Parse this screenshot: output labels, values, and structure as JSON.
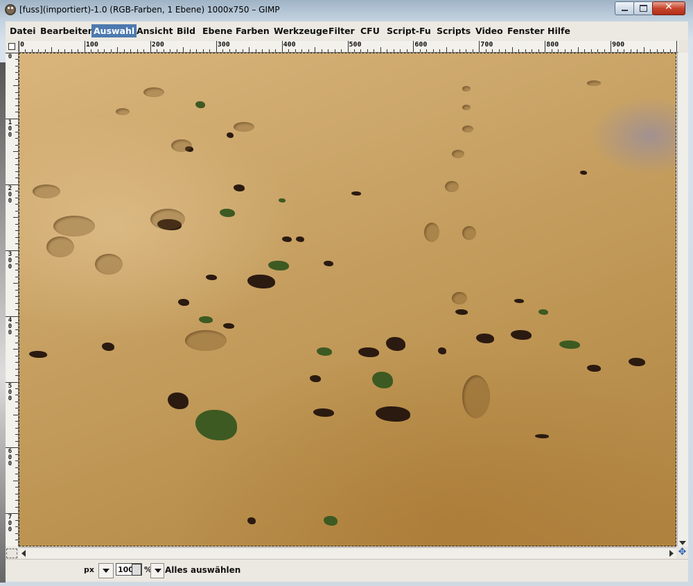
{
  "window": {
    "title": "[fuss](importiert)-1.0 (RGB-Farben, 1 Ebene) 1000x750 – GIMP",
    "app_icon": "gimp-wilber-icon"
  },
  "menubar": {
    "items": [
      {
        "label": "Datei"
      },
      {
        "label": "Bearbeiten"
      },
      {
        "label": "Auswahl",
        "active": true
      },
      {
        "label": "Ansicht"
      },
      {
        "label": "Bild"
      },
      {
        "label": "Ebene"
      },
      {
        "label": "Farben"
      },
      {
        "label": "Werkzeuge"
      },
      {
        "label": "Filter"
      },
      {
        "label": "CFU"
      },
      {
        "label": "Script-Fu"
      },
      {
        "label": "Scripts"
      },
      {
        "label": "Video"
      },
      {
        "label": "Fenster"
      },
      {
        "label": "Hilfe"
      }
    ]
  },
  "rulers": {
    "horizontal": [
      "0",
      "100",
      "200",
      "300",
      "400",
      "500",
      "600",
      "700",
      "800",
      "900"
    ],
    "vertical": [
      "0",
      "100",
      "200",
      "300",
      "400",
      "500",
      "600",
      "700"
    ]
  },
  "statusbar": {
    "unit": "px",
    "zoom_value": "100",
    "zoom_unit": "%",
    "message": "Alles auswählen"
  },
  "colors": {
    "menu_active": "#4d7ab0",
    "sand": "#c9a366"
  }
}
